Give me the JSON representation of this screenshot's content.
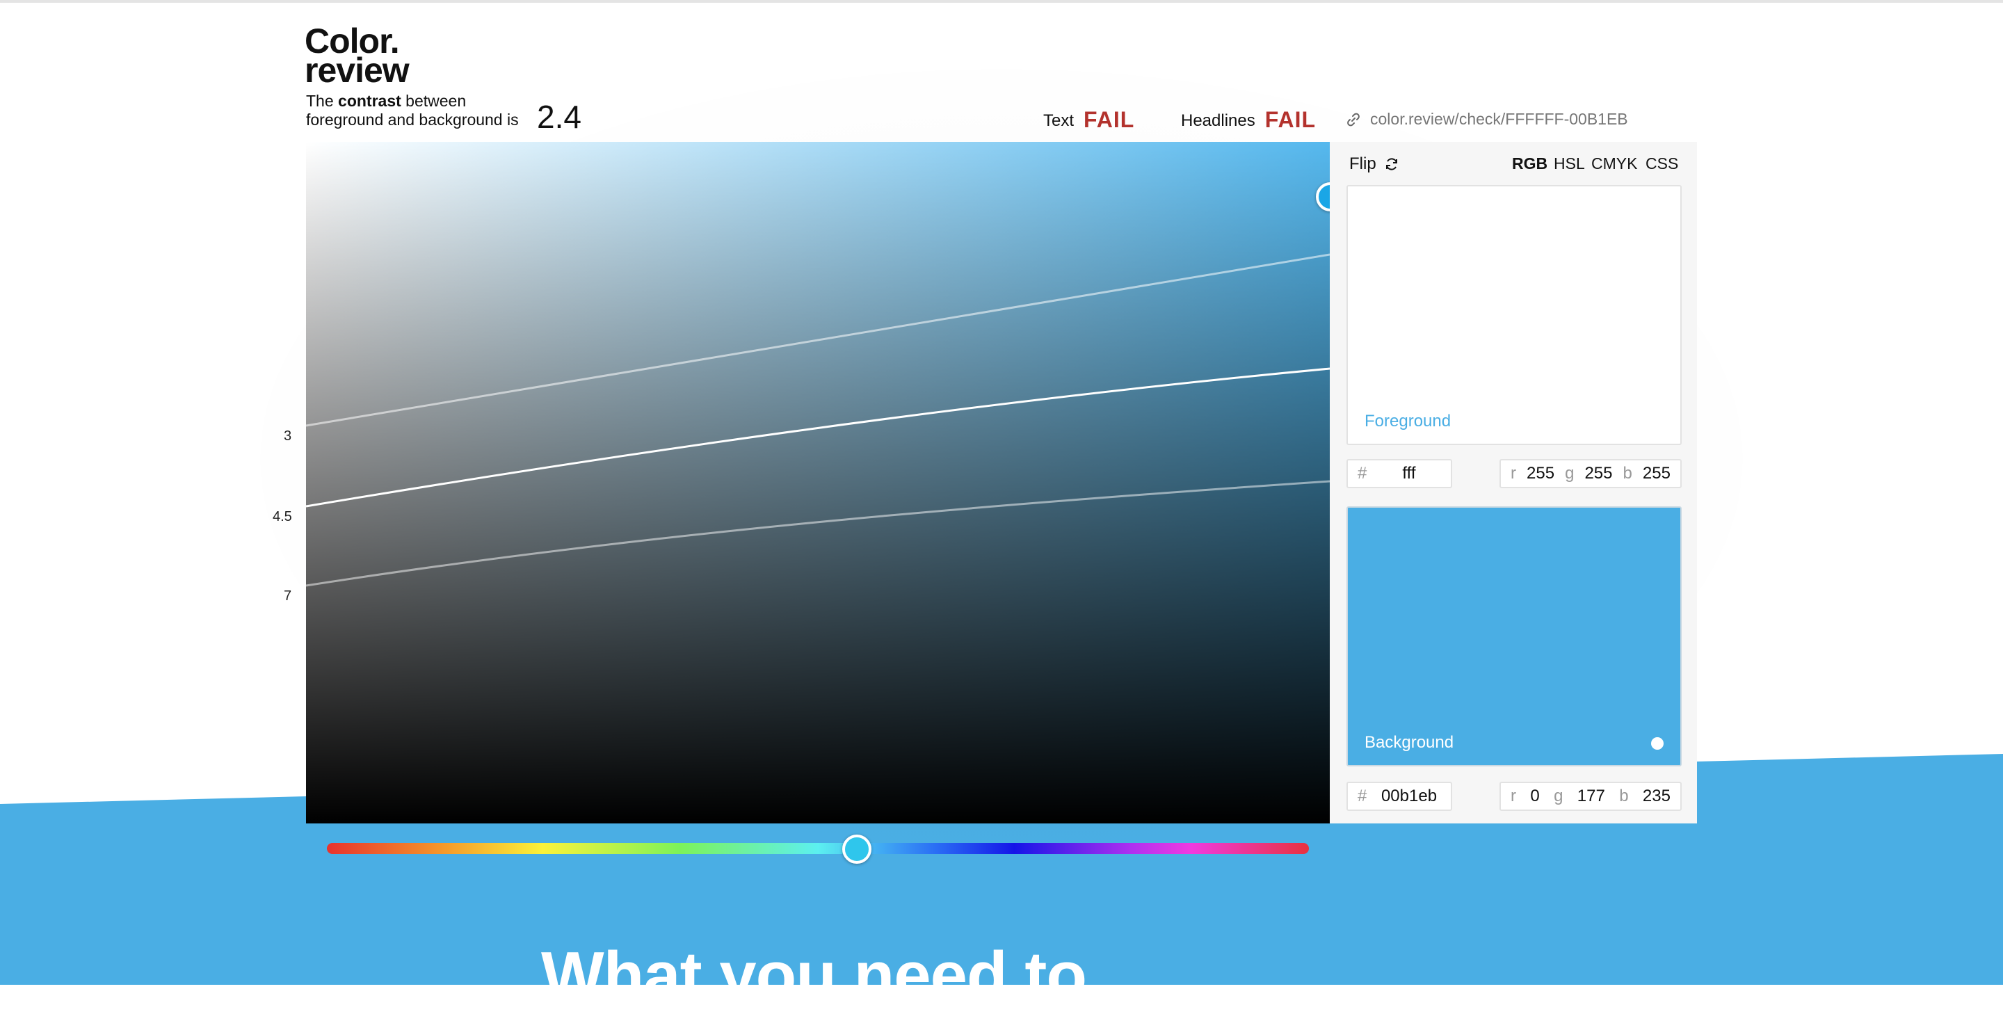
{
  "logo": {
    "line1": "Color.",
    "line2": "review"
  },
  "contrast": {
    "prefix": "The ",
    "bold": "contrast",
    "suffix": " between",
    "line2": "foreground and background is",
    "ratio": "2.4"
  },
  "verdicts": {
    "text_label": "Text",
    "text_result": "FAIL",
    "headline_label": "Headlines",
    "headline_result": "FAIL"
  },
  "share_url": "color.review/check/FFFFFF-00B1EB",
  "picker": {
    "contrast_lines": [
      "3",
      "4.5",
      "7"
    ],
    "hue_value": 0.54
  },
  "panel": {
    "flip_label": "Flip",
    "modes": [
      "RGB",
      "HSL",
      "CMYK",
      "CSS"
    ],
    "active_mode": "RGB",
    "foreground": {
      "label": "Foreground",
      "color": "#ffffff",
      "hash": "#",
      "hex": "fff",
      "r_key": "r",
      "r": "255",
      "g_key": "g",
      "g": "255",
      "b_key": "b",
      "b": "255"
    },
    "background": {
      "label": "Background",
      "color": "#4aaee4",
      "hash": "#",
      "hex": "00b1eb",
      "r_key": "r",
      "r": "0",
      "g_key": "g",
      "g": "177",
      "b_key": "b",
      "b": "235"
    }
  },
  "headline_text": "What you need to",
  "colors": {
    "accent": "#4aaee4",
    "fail": "#b3322d"
  },
  "icons": {
    "share": "link-icon",
    "flip": "refresh-icon"
  }
}
